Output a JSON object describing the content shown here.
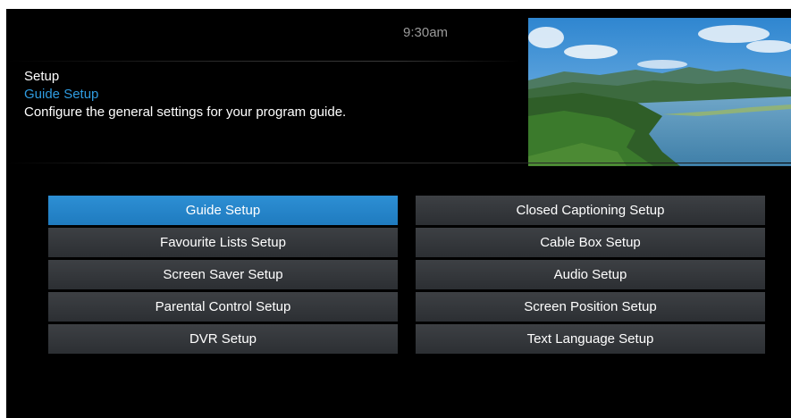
{
  "clock": "9:30am",
  "header": {
    "title": "Setup",
    "subtitle": "Guide Setup",
    "description": "Configure the general settings for your program guide."
  },
  "menu": {
    "left": [
      {
        "label": "Guide Setup",
        "selected": true
      },
      {
        "label": "Favourite Lists Setup"
      },
      {
        "label": "Screen Saver Setup"
      },
      {
        "label": "Parental Control Setup"
      },
      {
        "label": "DVR Setup"
      }
    ],
    "right": [
      {
        "label": "Closed Captioning Setup"
      },
      {
        "label": "Cable Box Setup"
      },
      {
        "label": "Audio Setup"
      },
      {
        "label": "Screen Position Setup"
      },
      {
        "label": "Text Language Setup"
      }
    ]
  },
  "colors": {
    "background": "#000000",
    "accent": "#2f9be0",
    "selected_button": "#2d8fd4",
    "button": "#35383c"
  }
}
